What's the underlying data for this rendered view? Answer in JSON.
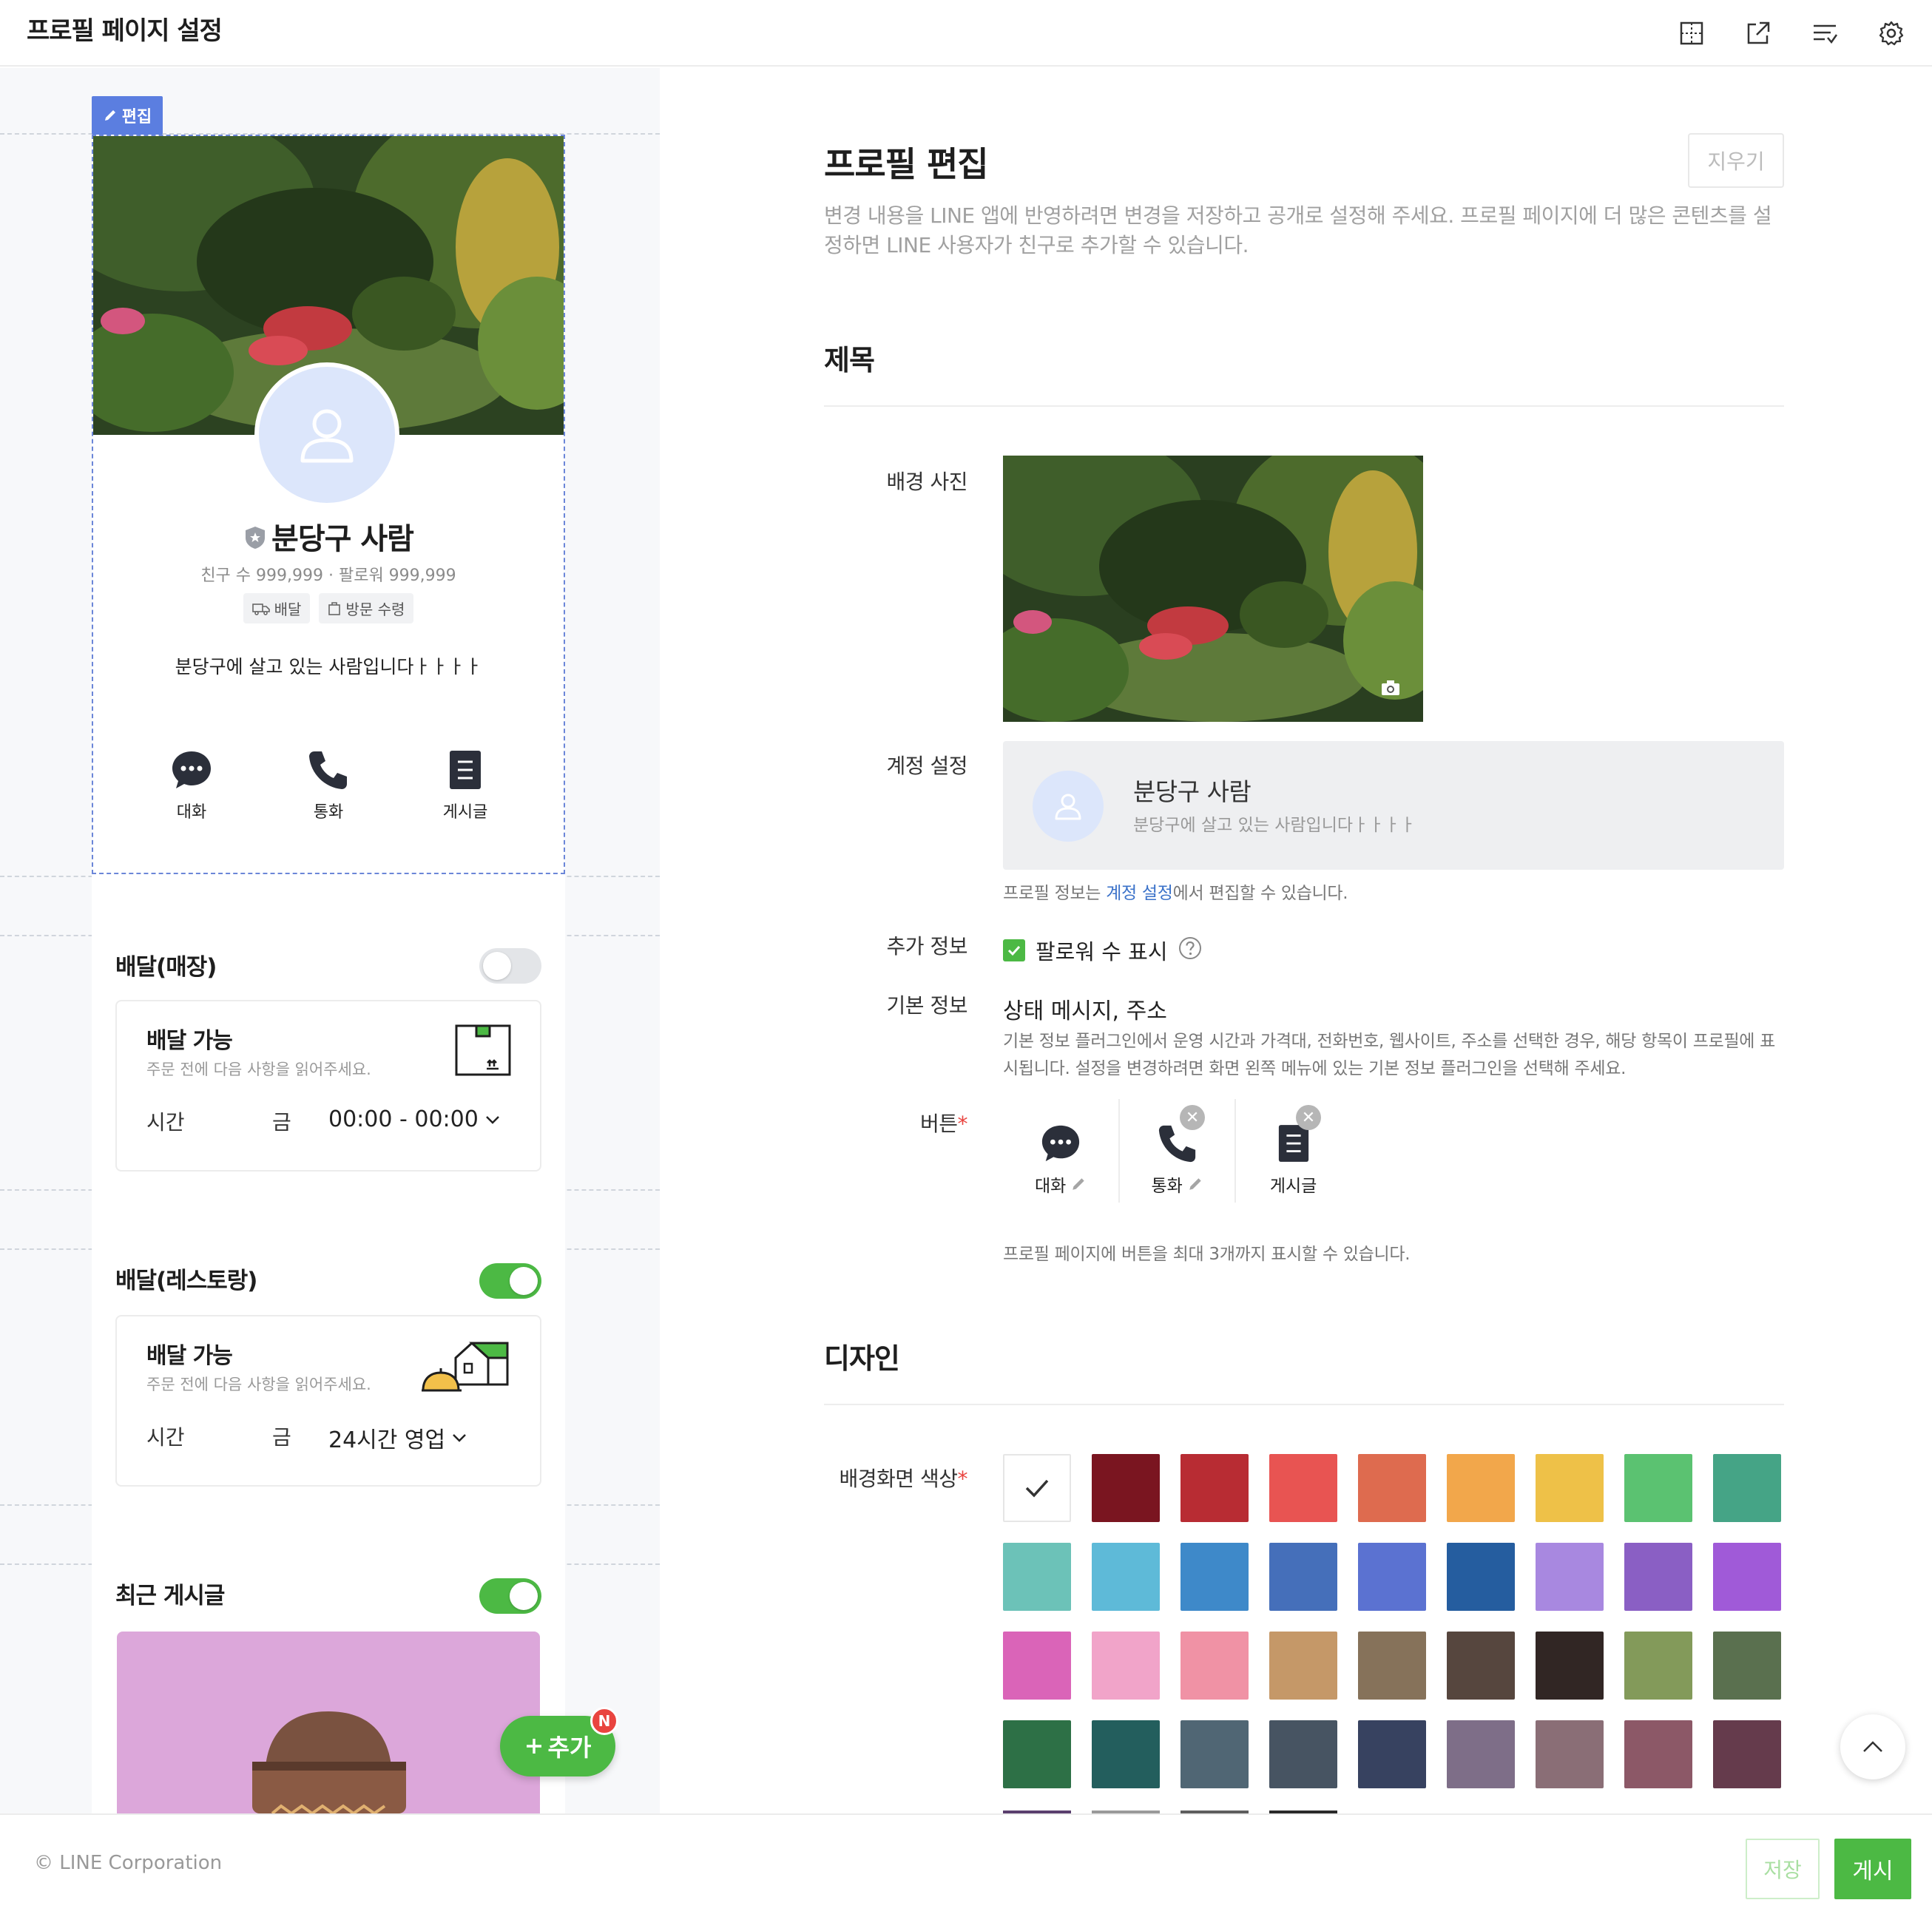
{
  "header": {
    "title": "프로필 페이지 설정",
    "icons": [
      "layout-grid-icon",
      "external-link-icon",
      "sort-list-icon",
      "gear-icon"
    ]
  },
  "preview": {
    "edit_tag": "편집",
    "profile": {
      "name": "분당구 사람",
      "stats": "친구 수 999,999 · 팔로워 999,999",
      "tags": [
        "배달",
        "방문 수령"
      ],
      "status": "분당구에 살고 있는 사람입니다ㅏㅏㅏㅏ",
      "actions": [
        {
          "label": "대화",
          "icon": "chat-icon"
        },
        {
          "label": "통화",
          "icon": "phone-icon"
        },
        {
          "label": "게시글",
          "icon": "post-icon"
        }
      ]
    },
    "delivery_store": {
      "title": "배달(매장)",
      "enabled": false,
      "card_title": "배달 가능",
      "card_sub": "주문 전에 다음 사항을 읽어주세요.",
      "hours_label": "시간",
      "day": "금",
      "time": "00:00 - 00:00"
    },
    "delivery_restaurant": {
      "title": "배달(레스토랑)",
      "enabled": true,
      "card_title": "배달 가능",
      "card_sub": "주문 전에 다음 사항을 읽어주세요.",
      "hours_label": "시간",
      "day": "금",
      "time": "24시간 영업"
    },
    "recent_posts": {
      "title": "최근 게시글",
      "enabled": true
    },
    "add_button": {
      "label": "추가",
      "badge": "N"
    }
  },
  "editor": {
    "title": "프로필 편집",
    "clear_label": "지우기",
    "description": "변경 내용을 LINE 앱에 반영하려면 변경을 저장하고 공개로 설정해 주세요. 프로필 페이지에 더 많은 콘텐츠를 설정하면 LINE 사용자가 친구로 추가할 수 있습니다.",
    "section_title": "제목",
    "bg_photo_label": "배경 사진",
    "account_label": "계정 설정",
    "account": {
      "name": "분당구 사람",
      "status": "분당구에 살고 있는 사람입니다ㅏㅏㅏㅏ"
    },
    "account_note_pre": "프로필 정보는 ",
    "account_note_link": "계정 설정",
    "account_note_post": "에서 편집할 수 있습니다.",
    "extra_label": "추가 정보",
    "extra_checkbox": "팔로워 수 표시",
    "extra_checked": true,
    "basic_label": "기본 정보",
    "basic_value": "상태 메시지, 주소",
    "basic_desc": "기본 정보 플러그인에서 운영 시간과 가격대, 전화번호, 웹사이트, 주소를 선택한 경우, 해당 항목이 프로필에 표시됩니다. 설정을 변경하려면 화면 왼쪽 메뉴에 있는 기본 정보 플러그인을 선택해 주세요.",
    "buttons_label": "버튼",
    "required_mark": "*",
    "buttons": [
      {
        "label": "대화",
        "icon": "chat-icon"
      },
      {
        "label": "통화",
        "icon": "phone-icon"
      },
      {
        "label": "게시글",
        "icon": "post-icon"
      }
    ],
    "buttons_note": "프로필 페이지에 버튼을 최대 3개까지 표시할 수 있습니다.",
    "design_title": "디자인",
    "bg_color_label": "배경화면 색상",
    "colors": [
      "#ffffff",
      "#7a1520",
      "#b82c33",
      "#e85452",
      "#de6b4f",
      "#f2a74b",
      "#eec148",
      "#5bc271",
      "#45a486",
      "#6cc2b8",
      "#5ebad8",
      "#3e89c9",
      "#456fba",
      "#5b72d1",
      "#255d9f",
      "#a888e0",
      "#8a5fc4",
      "#a05ad8",
      "#da64b8",
      "#f1a4c9",
      "#f092a5",
      "#c59868",
      "#86725a",
      "#56463e",
      "#312624",
      "#839a5a",
      "#5a704f",
      "#2d7046",
      "#235e5d",
      "#506674",
      "#475462",
      "#374260",
      "#7e6e88",
      "#8a6e76",
      "#8c5867",
      "#653b4c"
    ],
    "selected_color_index": 0
  },
  "footer": {
    "copyright": "© LINE Corporation",
    "save_label": "저장",
    "publish_label": "게시"
  }
}
